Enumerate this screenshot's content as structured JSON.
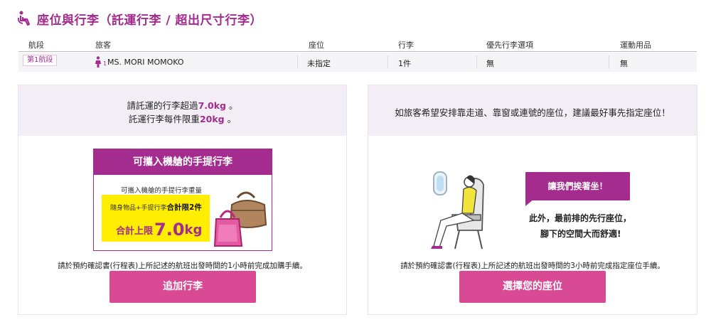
{
  "header": {
    "title": "座位與行李（託運行李 / 超出尺寸行李）",
    "icon": "accessible-seat-icon"
  },
  "table": {
    "headers": [
      "航段",
      "旅客",
      "座位",
      "行李",
      "優先行李選項",
      "運動用品"
    ],
    "row": {
      "segment": "第1航段",
      "passenger_index": "1",
      "passenger_name": "MS. MORI MOMOKO",
      "seat": "未指定",
      "baggage": "1件",
      "priority": "無",
      "sports": "無"
    }
  },
  "left_panel": {
    "line1_pre": "請託運的行李超過",
    "line1_hl": "7.0kg",
    "line1_post": " 。",
    "line2_pre": "託運行李每件限重",
    "line2_hl": "20kg",
    "line2_post": " 。",
    "card_title": "可攜入機艙的手提行李",
    "card_sub": "可攜入機艙的手提行李重量",
    "card_line1_pre": "隨身物品+手提行李",
    "card_line1_bold": "合計限2件",
    "card_line2_pre": "合計上限",
    "card_line2_big": "7.0",
    "card_line2_unit": "kg",
    "note": "請於預約確認書(行程表)上所記述的航班出發時間的1小時前完成加購手續。",
    "button": "追加行李"
  },
  "right_panel": {
    "line1": "如旅客希望安排靠走道、靠窗或連號的座位，建議最好事先指定座位！",
    "bubble": "讓我們挨著坐！",
    "body1": "此外，最前排的先行座位，",
    "body2": "腳下的空間大而舒適!",
    "note": "請於預約確認書(行程表)上所記述的航班出發時間的3小時前完成指定座位手續。",
    "button": "選擇您的座位"
  },
  "colors": {
    "brand": "#a32c8e",
    "button": "#d84a93",
    "panel_top": "#f3eef5",
    "highlight_box": "#ffee00"
  }
}
